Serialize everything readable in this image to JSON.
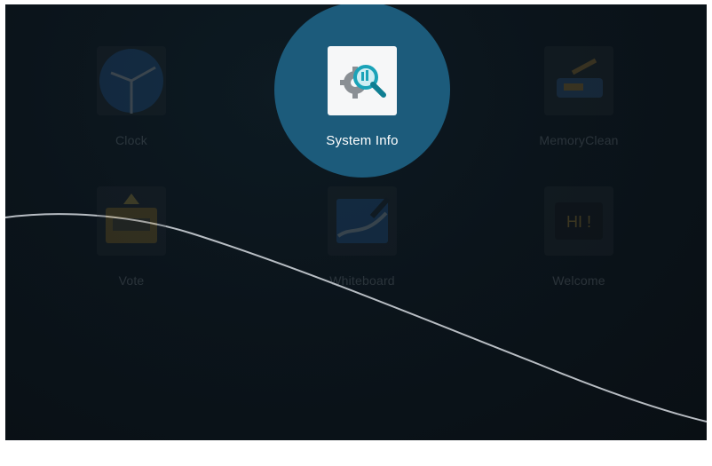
{
  "apps": [
    {
      "label": "Clock",
      "icon": "clock-icon"
    },
    {
      "label": "System Info",
      "icon": "system-info-icon",
      "focused": true
    },
    {
      "label": "MemoryClean",
      "icon": "memory-clean-icon"
    },
    {
      "label": "Vote",
      "icon": "vote-icon"
    },
    {
      "label": "Whiteboard",
      "icon": "whiteboard-icon"
    },
    {
      "label": "Welcome",
      "icon": "welcome-icon"
    }
  ],
  "welcome_icon_text": "HI !",
  "colors": {
    "background": "#0b141b",
    "focus_highlight": "#1c5b7b",
    "label_active": "#ffffff",
    "label_dim": "#9aa3aa"
  }
}
